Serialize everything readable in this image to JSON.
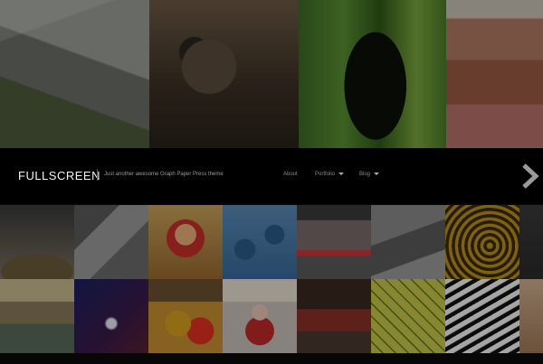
{
  "header": {
    "site_title": "FULLSCREEN",
    "tagline": "Just another awesome Graph Paper Press theme",
    "nav": [
      {
        "label": "About",
        "has_dropdown": false
      },
      {
        "label": "Portfolio",
        "has_dropdown": true
      },
      {
        "label": "Blog",
        "has_dropdown": true
      }
    ]
  },
  "colors": {
    "header_background": "#000000",
    "title_text": "#f4f4f4",
    "nav_text": "#8a8a8a"
  },
  "icons": {
    "next": "chevron-right-icon",
    "dropdown": "caret-down-icon"
  }
}
